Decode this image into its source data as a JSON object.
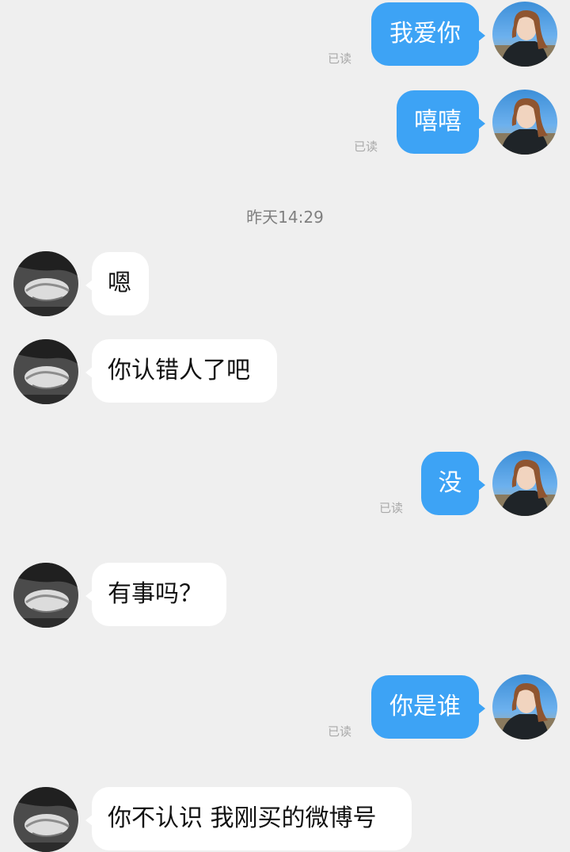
{
  "chat": {
    "timestamp": "昨天14:29",
    "messages": [
      {
        "side": "outgoing",
        "text": "我爱你",
        "read": "已读"
      },
      {
        "side": "outgoing",
        "text": "嘻嘻",
        "read": "已读"
      },
      {
        "side": "incoming",
        "text": "嗯"
      },
      {
        "side": "incoming",
        "text": "你认错人了吧"
      },
      {
        "side": "outgoing",
        "text": "没",
        "read": "已读"
      },
      {
        "side": "incoming",
        "text": "有事吗？"
      },
      {
        "side": "outgoing",
        "text": "你是谁",
        "read": "已读"
      },
      {
        "side": "incoming",
        "text": "你不认识 我刚买的微博号"
      }
    ]
  },
  "colors": {
    "background": "#efefef",
    "outgoing_bubble": "#3da3f5",
    "incoming_bubble": "#ffffff",
    "read_text": "#a9a9a9",
    "timestamp_text": "#7f7f7f"
  }
}
